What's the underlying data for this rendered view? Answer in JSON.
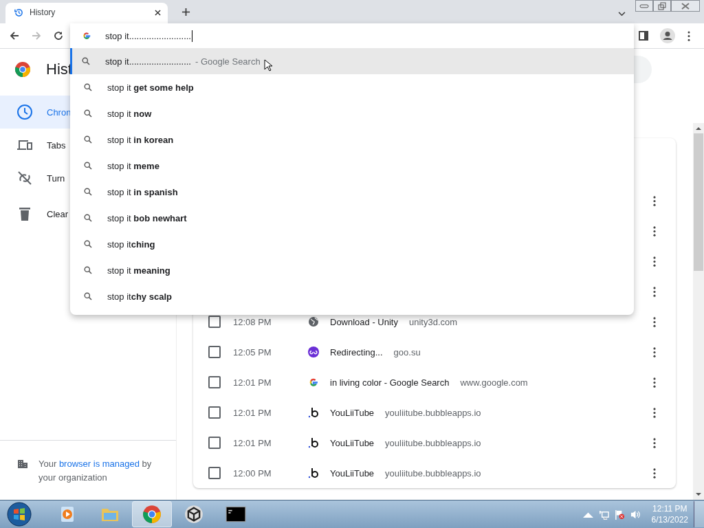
{
  "tab": {
    "title": "History",
    "selected": true
  },
  "omnibox": {
    "value": "stop it........................."
  },
  "suggestions": [
    {
      "text": "stop it.........................",
      "suffix": "- Google Search",
      "selected": true
    },
    {
      "text": "stop it **get some help**",
      "selected": false
    },
    {
      "text": "stop it **now**",
      "selected": false
    },
    {
      "text": "stop it **in korean**",
      "selected": false
    },
    {
      "text": "stop it **meme**",
      "selected": false
    },
    {
      "text": "stop it **in spanish**",
      "selected": false
    },
    {
      "text": "stop it **bob newhart**",
      "selected": false
    },
    {
      "text": "stop it**ching**",
      "selected": false
    },
    {
      "text": "stop it **meaning**",
      "selected": false
    },
    {
      "text": "stop it**chy scalp**",
      "selected": false
    }
  ],
  "page_title": "Hist",
  "sidebar": {
    "items": [
      {
        "label": "Chron",
        "selected": true
      },
      {
        "label": "Tabs",
        "selected": false
      },
      {
        "label": "Turn",
        "selected": false
      },
      {
        "label": "Clear",
        "selected": false
      }
    ],
    "footer": {
      "text_before": "Your",
      "link": "browser is managed",
      "text_after": "by your organization"
    }
  },
  "rows": [
    {
      "kind": "covered"
    },
    {
      "kind": "covered"
    },
    {
      "kind": "covered"
    },
    {
      "kind": "covered"
    },
    {
      "kind": "globe",
      "checked": false,
      "time": "12:08 PM",
      "title": "Download - Unity",
      "domain": "unity3d.com"
    },
    {
      "kind": "link",
      "checked": false,
      "time": "12:05 PM",
      "title": "Redirecting...",
      "domain": "goo.su"
    },
    {
      "kind": "google",
      "checked": false,
      "time": "12:01 PM",
      "title": "in living color - Google Search",
      "domain": "www.google.com"
    },
    {
      "kind": "bubble",
      "checked": false,
      "time": "12:01 PM",
      "title": "YouLiiTube",
      "domain": "youliitube.bubbleapps.io"
    },
    {
      "kind": "bubble",
      "checked": false,
      "time": "12:01 PM",
      "title": "YouLiiTube",
      "domain": "youliitube.bubbleapps.io"
    },
    {
      "kind": "bubble",
      "checked": false,
      "time": "12:00 PM",
      "title": "YouLiiTube",
      "domain": "youliitube.bubbleapps.io"
    }
  ],
  "taskbar": {
    "apps": [
      {
        "active": false
      },
      {
        "active": false
      },
      {
        "active": true
      },
      {
        "active": false
      },
      {
        "active": false
      }
    ],
    "time": "12:11 PM",
    "date": "6/13/2022"
  }
}
